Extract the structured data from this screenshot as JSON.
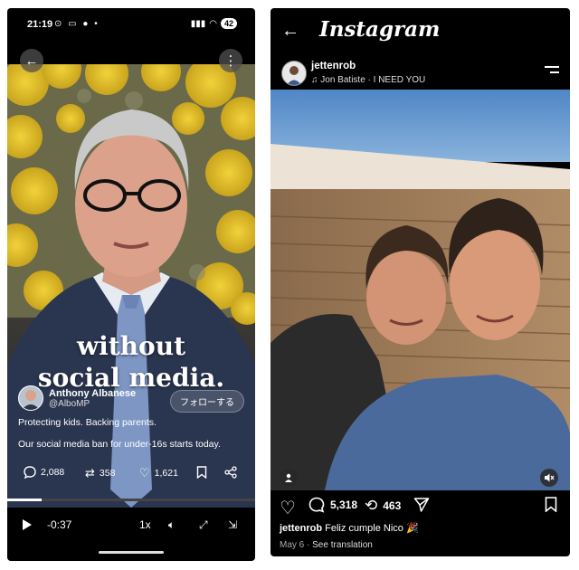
{
  "left": {
    "status": {
      "time": "21:19",
      "icons": "⊙ ▭ ●  •",
      "battery": "42"
    },
    "caption": {
      "line1": "without",
      "line2": "social media."
    },
    "author": {
      "name": "Anthony Albanese",
      "handle": "@AlboMP",
      "follow": "フォローする"
    },
    "post": {
      "line1": "Protecting kids. Backing parents.",
      "line2": "Our social media ban for under-16s starts today."
    },
    "stats": {
      "replies": "2,088",
      "reposts": "358",
      "likes": "1,621"
    },
    "player": {
      "time_remaining": "-0:37",
      "speed": "1x",
      "progress": 0.14
    }
  },
  "right": {
    "app_title": "Instagram",
    "user": {
      "username": "jettenrob",
      "music": "Jon Batiste · I NEED YOU"
    },
    "stats": {
      "comments": "5,318",
      "shares": "463"
    },
    "caption": {
      "username": "jettenrob",
      "text": "Feliz cumple Nico 🎉"
    },
    "meta": {
      "date": "May 6",
      "separator": "·",
      "translate": "See translation"
    }
  }
}
